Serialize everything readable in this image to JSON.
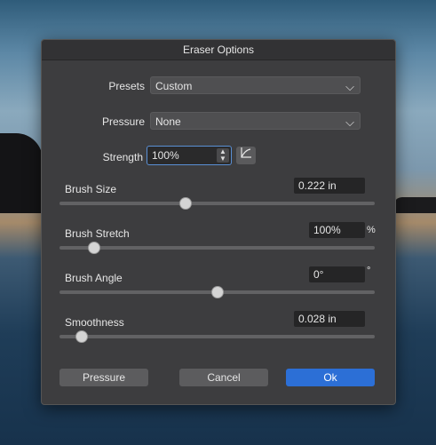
{
  "dialog": {
    "title": "Eraser Options",
    "presets": {
      "label": "Presets",
      "value": "Custom"
    },
    "pressure": {
      "label": "Pressure",
      "value": "None"
    },
    "strength": {
      "label": "Strength",
      "value": "100%"
    },
    "sliders": [
      {
        "label": "Brush Size",
        "value": "0.222 in",
        "unit": "",
        "level": 0.4
      },
      {
        "label": "Brush Stretch",
        "value": "100%",
        "unit": "%",
        "level": 0.11
      },
      {
        "label": "Brush Angle",
        "value": "0°",
        "unit": "°",
        "level": 0.5
      },
      {
        "label": "Smoothness",
        "value": "0.028 in",
        "unit": "",
        "level": 0.07
      }
    ],
    "buttons": {
      "pressure": "Pressure",
      "cancel": "Cancel",
      "ok": "Ok"
    }
  },
  "colors": {
    "accent": "#2c6fd6",
    "dialog_bg": "#3d3d3f",
    "titlebar_bg": "#323234"
  },
  "icons": {
    "chevron": "chevron-down-icon",
    "spinner": "stepper-arrows-icon",
    "curve": "pressure-curve-icon"
  }
}
